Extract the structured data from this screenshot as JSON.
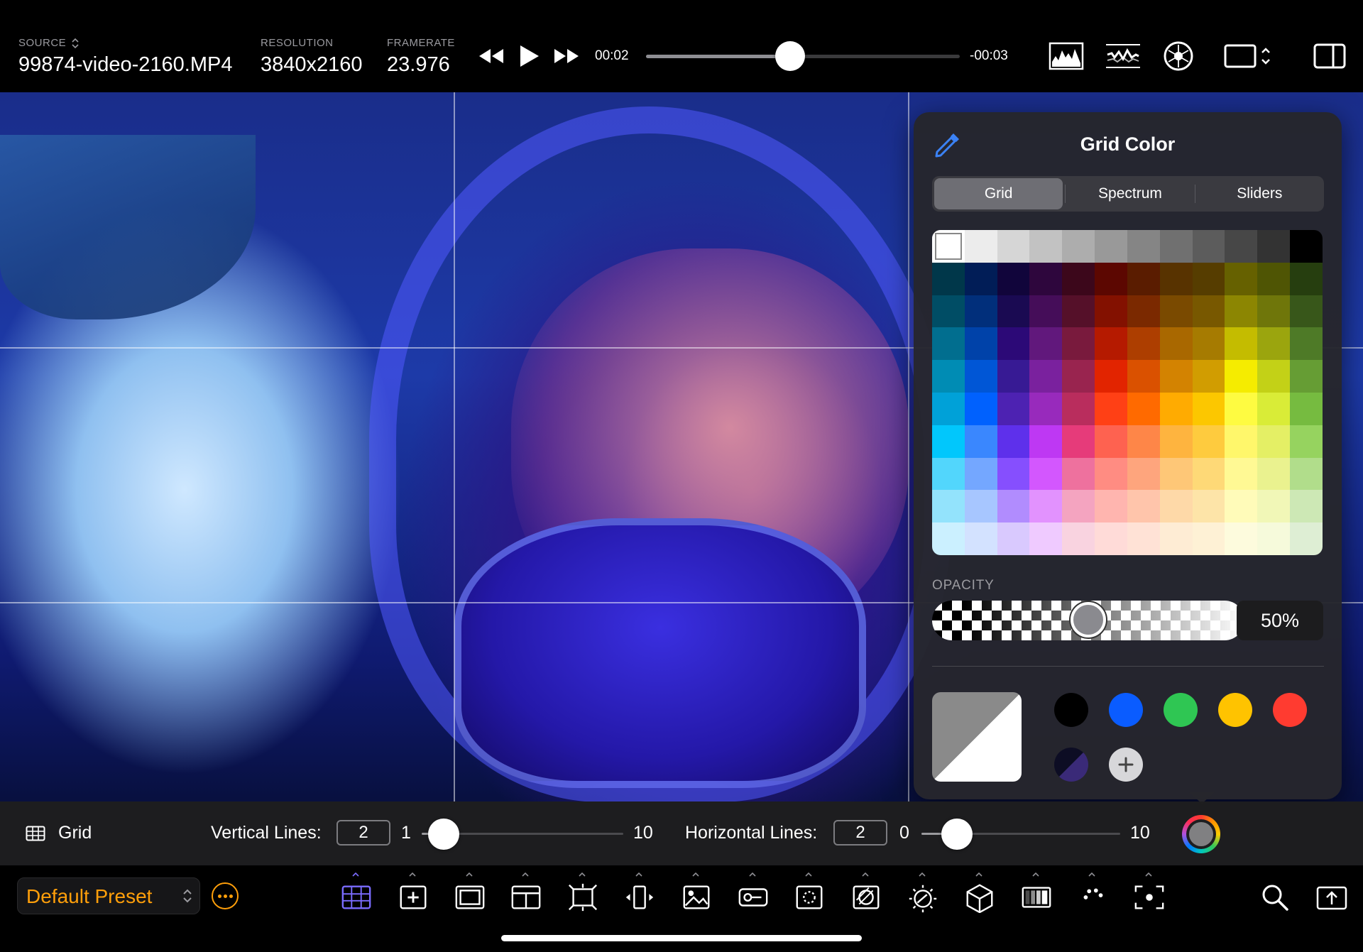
{
  "topbar": {
    "source_label": "SOURCE",
    "source_value": "99874-video-2160.MP4",
    "resolution_label": "RESOLUTION",
    "resolution_value": "3840x2160",
    "framerate_label": "FRAMERATE",
    "framerate_value": "23.976",
    "time_elapsed": "00:02",
    "time_remaining": "-00:03",
    "playhead_fraction": 0.46,
    "transport_icons": [
      "rewind-icon",
      "play-icon",
      "fast-forward-icon"
    ],
    "scope_icons": [
      "histogram-icon",
      "waveform-icon",
      "vectorscope-icon",
      "aspect-ratio-icon",
      "sidebar-icon"
    ]
  },
  "viewer": {
    "image_alt": "Rider in motocross helmet under blue light",
    "helmet_logo_text": "icon"
  },
  "popover": {
    "title": "Grid Color",
    "tabs": [
      "Grid",
      "Spectrum",
      "Sliders"
    ],
    "active_tab": "Grid",
    "palette_rows": [
      [
        "#ffffff",
        "#ececec",
        "#d6d6d6",
        "#c2c2c2",
        "#adadad",
        "#999999",
        "#858585",
        "#707070",
        "#5c5c5c",
        "#474747",
        "#333333",
        "#000000"
      ],
      [
        "#00374a",
        "#011d57",
        "#11053b",
        "#2e063d",
        "#3c071b",
        "#5c0701",
        "#5a1c00",
        "#583300",
        "#563d00",
        "#666100",
        "#4f5504",
        "#263e0f"
      ],
      [
        "#004d65",
        "#012f7b",
        "#1a0a52",
        "#450d59",
        "#551029",
        "#831100",
        "#7b2900",
        "#7a4a00",
        "#785800",
        "#8c8602",
        "#6f760a",
        "#38571a"
      ],
      [
        "#016e8f",
        "#0042a9",
        "#2c0977",
        "#61187c",
        "#791a3d",
        "#b51a00",
        "#ad3e00",
        "#a96800",
        "#a67b01",
        "#c4bc00",
        "#9ba50e",
        "#4e7a27"
      ],
      [
        "#008cb4",
        "#0056d6",
        "#371a94",
        "#7a219e",
        "#99244f",
        "#e22400",
        "#da5100",
        "#d38301",
        "#d19d01",
        "#f5ec00",
        "#c3d117",
        "#669d34"
      ],
      [
        "#00a1d8",
        "#0061fe",
        "#4d22b2",
        "#982abc",
        "#b92d5d",
        "#ff4015",
        "#ff6a00",
        "#ffab01",
        "#fcc700",
        "#fefb41",
        "#d9ec37",
        "#76bb40"
      ],
      [
        "#01c7fc",
        "#3a87fe",
        "#5e30eb",
        "#be38f3",
        "#e63b7a",
        "#fe6250",
        "#fe8648",
        "#feb43f",
        "#fecb3e",
        "#fff76b",
        "#e4ef65",
        "#96d35f"
      ],
      [
        "#52d6fc",
        "#74a7ff",
        "#864ffe",
        "#d357fe",
        "#ee719e",
        "#ff8c82",
        "#fea57d",
        "#fec777",
        "#fed977",
        "#fff994",
        "#eaf28f",
        "#b1dd8b"
      ],
      [
        "#93e3fc",
        "#a7c6ff",
        "#b18cfe",
        "#e292fe",
        "#f4a4c0",
        "#ffb5af",
        "#ffc5ab",
        "#fed9a8",
        "#fde4a8",
        "#fffbb9",
        "#f1f7b7",
        "#cde8b5"
      ],
      [
        "#cbf0ff",
        "#d3e2ff",
        "#d9c9fe",
        "#efcaff",
        "#f9d3e0",
        "#ffdbd8",
        "#ffe2d6",
        "#feecd4",
        "#fef1d5",
        "#fdfbdd",
        "#f6fadb",
        "#deeed4"
      ]
    ],
    "selected_swatch": "#ffffff",
    "opacity_label": "OPACITY",
    "opacity_fraction": 0.5,
    "opacity_value": "50%",
    "current_color": "#8a8a8a",
    "favorites": [
      "#000000",
      "#0a5cff",
      "#2fc653",
      "#ffc300",
      "#ff3b30"
    ],
    "favorites_row2": [
      "#1c1c54"
    ]
  },
  "gridbar": {
    "title": "Grid",
    "vertical_label": "Vertical Lines:",
    "vertical_value": "2",
    "vertical_min": "1",
    "vertical_max": "10",
    "vertical_fraction": 0.11,
    "horizontal_label": "Horizontal Lines:",
    "horizontal_value": "2",
    "horizontal_min": "0",
    "horizontal_max": "10",
    "horizontal_fraction": 0.18,
    "grid_color": "#808082"
  },
  "toolbar": {
    "preset": "Default Preset",
    "accent": "#ff9f0a",
    "active_tool_color": "#7b6cff",
    "tools": [
      "grid-tool-icon",
      "safe-area-icon",
      "frame-guide-icon",
      "layout-icon",
      "transform-icon",
      "flip-icon",
      "overlay-image-icon",
      "lut-icon",
      "focus-peaking-icon",
      "zebra-icon",
      "exposure-icon",
      "3d-lut-icon",
      "false-color-icon",
      "color-palette-icon",
      "frame-center-icon"
    ],
    "right_icons": [
      "search-icon",
      "share-icon"
    ]
  }
}
